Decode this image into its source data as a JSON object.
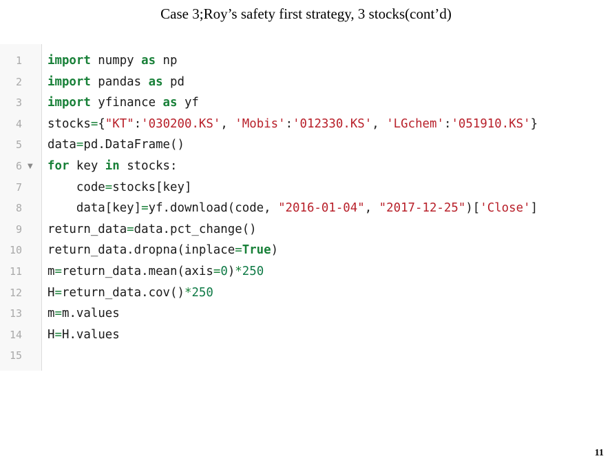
{
  "slide": {
    "title": "Case 3;Roy’s safety first strategy, 3 stocks(cont’d)",
    "page_number": "11"
  },
  "editor": {
    "lines": [
      {
        "number": "1",
        "tokens": [
          {
            "text": "import",
            "kind": "kw"
          },
          {
            "text": " numpy ",
            "kind": "plain"
          },
          {
            "text": "as",
            "kind": "kw"
          },
          {
            "text": " np",
            "kind": "plain"
          }
        ]
      },
      {
        "number": "2",
        "tokens": [
          {
            "text": "import",
            "kind": "kw"
          },
          {
            "text": " pandas ",
            "kind": "plain"
          },
          {
            "text": "as",
            "kind": "kw"
          },
          {
            "text": " pd",
            "kind": "plain"
          }
        ]
      },
      {
        "number": "3",
        "tokens": [
          {
            "text": "import",
            "kind": "kw"
          },
          {
            "text": " yfinance ",
            "kind": "plain"
          },
          {
            "text": "as",
            "kind": "kw"
          },
          {
            "text": " yf",
            "kind": "plain"
          }
        ]
      },
      {
        "number": "4",
        "tokens": [
          {
            "text": "stocks",
            "kind": "plain"
          },
          {
            "text": "=",
            "kind": "op"
          },
          {
            "text": "{",
            "kind": "plain"
          },
          {
            "text": "\"KT\"",
            "kind": "str"
          },
          {
            "text": ":",
            "kind": "plain"
          },
          {
            "text": "'030200.KS'",
            "kind": "str"
          },
          {
            "text": ", ",
            "kind": "plain"
          },
          {
            "text": "'Mobis'",
            "kind": "str"
          },
          {
            "text": ":",
            "kind": "plain"
          },
          {
            "text": "'012330.KS'",
            "kind": "str"
          },
          {
            "text": ", ",
            "kind": "plain"
          },
          {
            "text": "'LGchem'",
            "kind": "str"
          },
          {
            "text": ":",
            "kind": "plain"
          },
          {
            "text": "'051910.KS'",
            "kind": "str"
          },
          {
            "text": "}",
            "kind": "plain"
          }
        ]
      },
      {
        "number": "5",
        "tokens": [
          {
            "text": "data",
            "kind": "plain"
          },
          {
            "text": "=",
            "kind": "op"
          },
          {
            "text": "pd.DataFrame()",
            "kind": "plain"
          }
        ]
      },
      {
        "number": "6",
        "fold": true,
        "tokens": [
          {
            "text": "for",
            "kind": "kw"
          },
          {
            "text": " key ",
            "kind": "plain"
          },
          {
            "text": "in",
            "kind": "kw"
          },
          {
            "text": " stocks:",
            "kind": "plain"
          }
        ]
      },
      {
        "number": "7",
        "tokens": [
          {
            "text": "    code",
            "kind": "plain"
          },
          {
            "text": "=",
            "kind": "op"
          },
          {
            "text": "stocks[key]",
            "kind": "plain"
          }
        ]
      },
      {
        "number": "8",
        "tokens": [
          {
            "text": "    data[key]",
            "kind": "plain"
          },
          {
            "text": "=",
            "kind": "op"
          },
          {
            "text": "yf.download(code, ",
            "kind": "plain"
          },
          {
            "text": "\"2016-01-04\"",
            "kind": "str"
          },
          {
            "text": ", ",
            "kind": "plain"
          },
          {
            "text": "\"2017-12-25\"",
            "kind": "str"
          },
          {
            "text": ")[",
            "kind": "plain"
          },
          {
            "text": "'Close'",
            "kind": "str"
          },
          {
            "text": "]",
            "kind": "plain"
          }
        ]
      },
      {
        "number": "9",
        "tokens": [
          {
            "text": "return_data",
            "kind": "plain"
          },
          {
            "text": "=",
            "kind": "op"
          },
          {
            "text": "data.pct_change()",
            "kind": "plain"
          }
        ]
      },
      {
        "number": "10",
        "tokens": [
          {
            "text": "return_data.dropna(inplace",
            "kind": "plain"
          },
          {
            "text": "=",
            "kind": "op"
          },
          {
            "text": "True",
            "kind": "kw"
          },
          {
            "text": ")",
            "kind": "plain"
          }
        ]
      },
      {
        "number": "11",
        "tokens": [
          {
            "text": "m",
            "kind": "plain"
          },
          {
            "text": "=",
            "kind": "op"
          },
          {
            "text": "return_data.mean(axis",
            "kind": "plain"
          },
          {
            "text": "=",
            "kind": "op"
          },
          {
            "text": "0",
            "kind": "num"
          },
          {
            "text": ")",
            "kind": "plain"
          },
          {
            "text": "*",
            "kind": "op"
          },
          {
            "text": "250",
            "kind": "num"
          }
        ]
      },
      {
        "number": "12",
        "tokens": [
          {
            "text": "H",
            "kind": "plain"
          },
          {
            "text": "=",
            "kind": "op"
          },
          {
            "text": "return_data.cov()",
            "kind": "plain"
          },
          {
            "text": "*",
            "kind": "op"
          },
          {
            "text": "250",
            "kind": "num"
          }
        ]
      },
      {
        "number": "13",
        "tokens": [
          {
            "text": "m",
            "kind": "plain"
          },
          {
            "text": "=",
            "kind": "op"
          },
          {
            "text": "m.values",
            "kind": "plain"
          }
        ]
      },
      {
        "number": "14",
        "tokens": [
          {
            "text": "H",
            "kind": "plain"
          },
          {
            "text": "=",
            "kind": "op"
          },
          {
            "text": "H.values",
            "kind": "plain"
          }
        ]
      },
      {
        "number": "15",
        "tokens": []
      }
    ],
    "colors": {
      "keyword": "#188038",
      "string": "#b8202a",
      "number": "#0f7a46",
      "line_number": "#a9a9a9",
      "gutter_bg": "#f8f8f8"
    },
    "fold_icon": "fold-arrow-icon"
  }
}
